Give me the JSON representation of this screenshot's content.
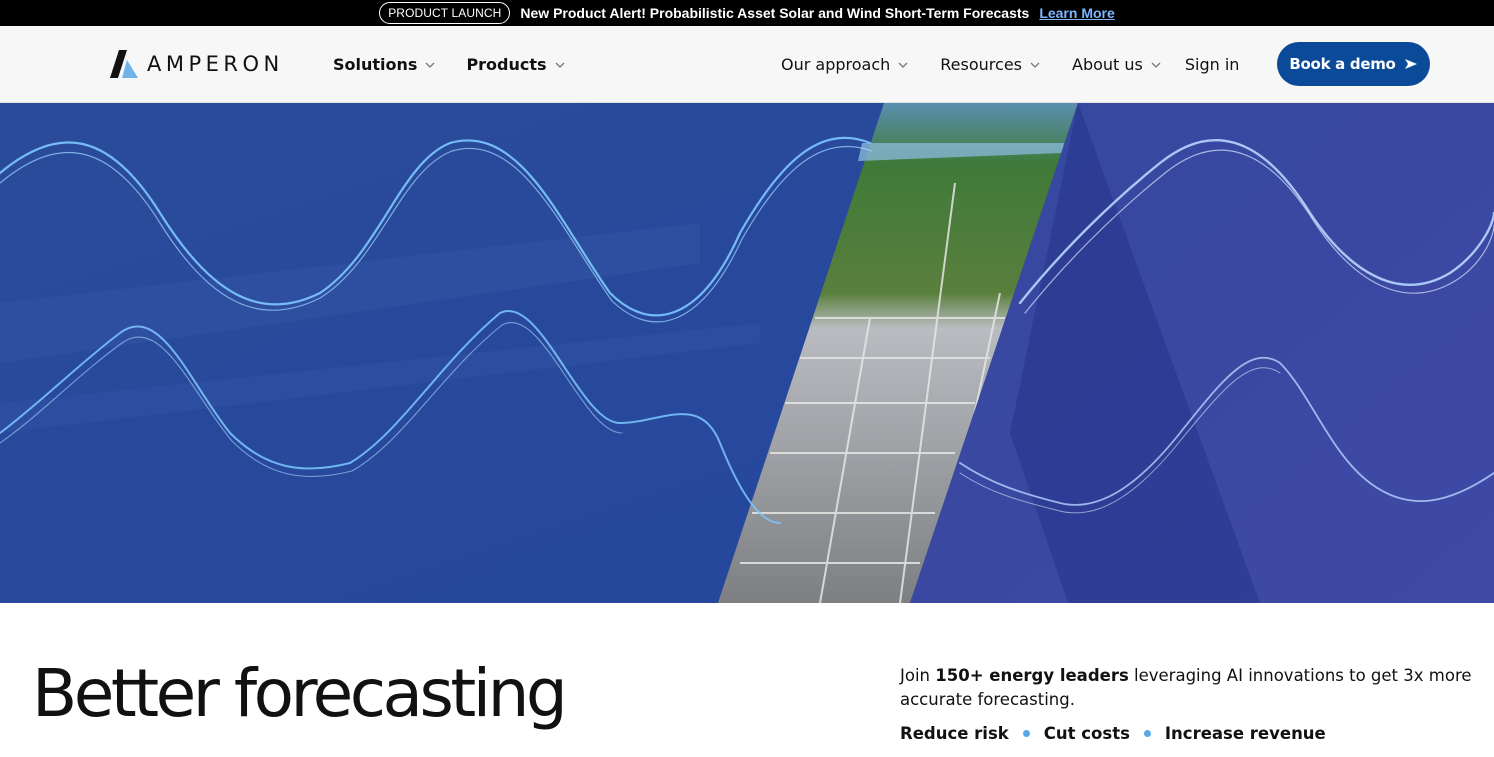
{
  "announcement": {
    "badge": "PRODUCT LAUNCH",
    "message": "New Product Alert! Probabilistic Asset Solar and Wind Short-Term Forecasts",
    "link": "Learn More"
  },
  "brand": {
    "name": "AMPERON"
  },
  "nav": {
    "left": [
      {
        "label": "Solutions"
      },
      {
        "label": "Products"
      }
    ],
    "right": [
      {
        "label": "Our approach"
      },
      {
        "label": "Resources"
      },
      {
        "label": "About us"
      }
    ],
    "signin": "Sign in",
    "cta": "Book a demo"
  },
  "hero": {
    "icon": "hero-wave-banner",
    "colors": {
      "primary": "#2a4aa0",
      "accent": "#6fc0ff"
    }
  },
  "main": {
    "headline": "Better forecasting",
    "intro_prefix": "Join ",
    "intro_bold": "150+ energy leaders",
    "intro_suffix": " leveraging AI innovations to get 3x more accurate forecasting.",
    "benefits": [
      "Reduce risk",
      "Cut costs",
      "Increase revenue"
    ]
  },
  "colors": {
    "cta_bg": "#0b4a98",
    "bullet": "#5aa7e6",
    "link": "#7bb6ff"
  }
}
